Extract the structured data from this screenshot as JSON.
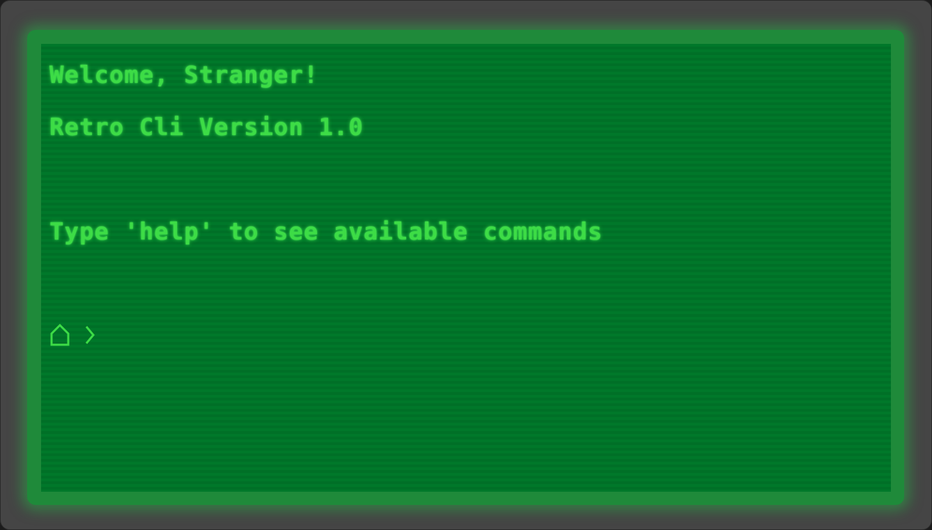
{
  "terminal": {
    "welcome": "Welcome, Stranger!",
    "version": "Retro Cli Version 1.0",
    "hint": "Type 'help' to see available commands",
    "prompt": {
      "location_icon": "home-icon",
      "separator_icon": "chevron-right-icon",
      "input_value": ""
    }
  },
  "colors": {
    "text": "#3ddc46",
    "screen": "#00782a",
    "frame": "#454545"
  }
}
